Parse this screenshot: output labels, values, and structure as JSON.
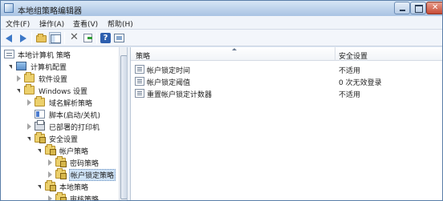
{
  "window": {
    "title": "本地组策略编辑器"
  },
  "menu": {
    "items": [
      "文件(F)",
      "操作(A)",
      "查看(V)",
      "帮助(H)"
    ]
  },
  "toolbar": {
    "buttons": [
      "back-arrow-icon",
      "forward-arrow-icon",
      "folder-up-icon",
      "show-pane-icon",
      "delete-icon",
      "export-icon",
      "help-icon",
      "view-icon"
    ]
  },
  "tree": {
    "items": [
      {
        "label": "本地计算机 策略"
      },
      {
        "label": "计算机配置"
      },
      {
        "label": "软件设置"
      },
      {
        "label": "Windows 设置"
      },
      {
        "label": "域名解析策略"
      },
      {
        "label": "脚本(启动/关机)"
      },
      {
        "label": "已部署的打印机"
      },
      {
        "label": "安全设置"
      },
      {
        "label": "帐户策略"
      },
      {
        "label": "密码策略"
      },
      {
        "label": "帐户锁定策略"
      },
      {
        "label": "本地策略"
      },
      {
        "label": "审核策略"
      }
    ]
  },
  "list": {
    "columns": {
      "name": "策略",
      "setting": "安全设置"
    },
    "rows": [
      {
        "name": "帐户锁定时间",
        "setting": "不适用"
      },
      {
        "name": "帐户锁定阈值",
        "setting": "0 次无效登录"
      },
      {
        "name": "重置帐户锁定计数器",
        "setting": "不适用"
      }
    ]
  }
}
